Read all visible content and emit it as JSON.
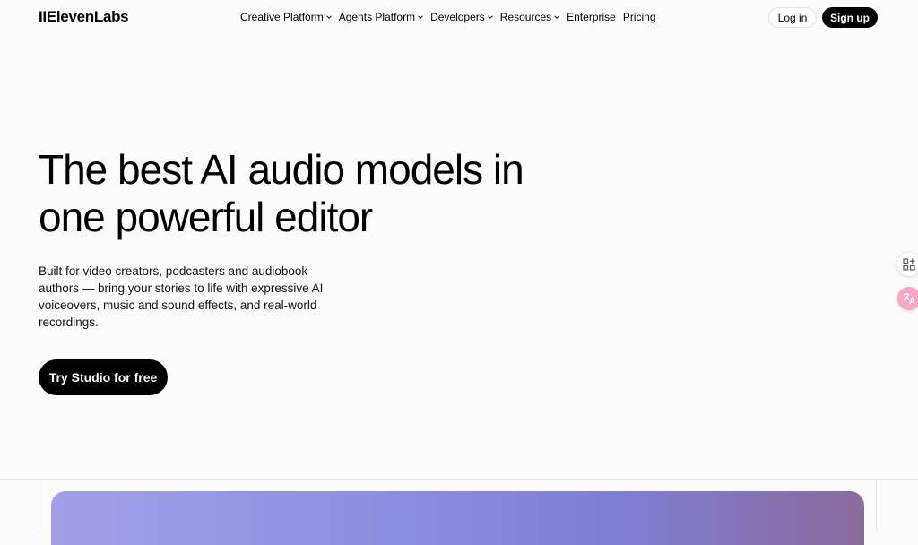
{
  "brand": {
    "logo_text": "IIElevenLabs"
  },
  "nav": {
    "items": [
      {
        "label": "Creative Platform",
        "has_dropdown": true
      },
      {
        "label": "Agents Platform",
        "has_dropdown": true
      },
      {
        "label": "Developers",
        "has_dropdown": true
      },
      {
        "label": "Resources",
        "has_dropdown": true
      },
      {
        "label": "Enterprise",
        "has_dropdown": false
      },
      {
        "label": "Pricing",
        "has_dropdown": false
      }
    ],
    "login_label": "Log in",
    "signup_label": "Sign up"
  },
  "hero": {
    "title_line1": "The best AI audio models in",
    "title_line2": "one powerful editor",
    "subtitle": "Built for video creators, podcasters and audiobook authors — bring your stories to life with expressive AI voiceovers, music and sound effects, and real-world recordings.",
    "cta_label": "Try Studio for free"
  },
  "side_tools": [
    {
      "icon": "apps-add-icon"
    },
    {
      "icon": "translate-icon"
    }
  ],
  "colors": {
    "background": "#fcfcfc",
    "primary": "#000000",
    "preview_gradient_start": "#a2a0e8",
    "preview_gradient_end": "#8a6c9c"
  }
}
